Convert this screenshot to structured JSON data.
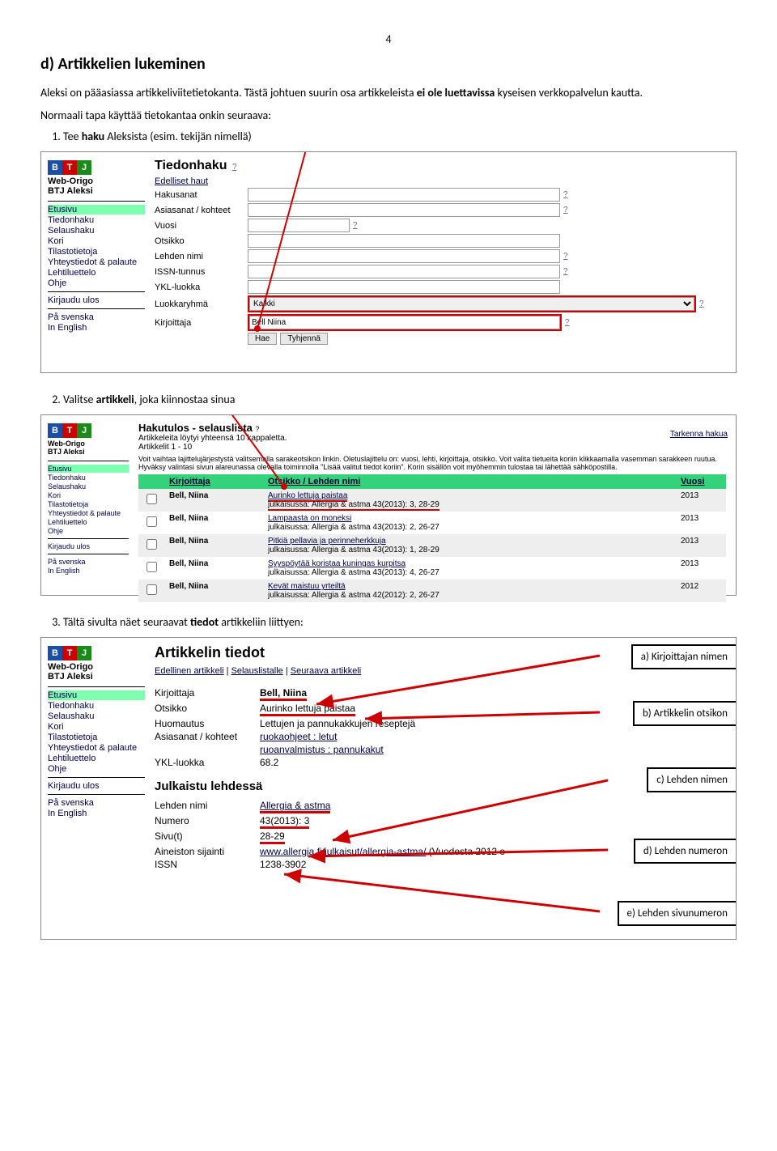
{
  "page_number": "4",
  "heading": "d) Artikkelien lukeminen",
  "para1_a": "Aleksi on pääasiassa artikkeliviitetietokanta. Tästä johtuen suurin osa artikkeleista ",
  "para1_b": "ei ole luettavissa",
  "para1_c": " kyseisen verkkopalvelun kautta.",
  "para2": "Normaali tapa käyttää tietokantaa onkin seuraava:",
  "step1_a": "Tee ",
  "step1_b": "haku",
  "step1_c": " Aleksista (esim. tekijän nimellä)",
  "step2_a": "Valitse ",
  "step2_b": "artikkeli",
  "step2_c": ", joka kiinnostaa sinua",
  "step3_a": "Tältä sivulta näet seuraavat ",
  "step3_b": "tiedot",
  "step3_c": " artikkeliin liittyen:",
  "logo": {
    "b": "B",
    "t": "T",
    "j": "J"
  },
  "brand1": "Web-Origo",
  "brand2": "BTJ Aleksi",
  "nav": {
    "etusivu": "Etusivu",
    "tiedonhaku": "Tiedonhaku",
    "selaushaku": "Selaushaku",
    "kori": "Kori",
    "tilasto": "Tilastotietoja",
    "yhteys": "Yhteystiedot & palaute",
    "lehti": "Lehtiluettelo",
    "ohje": "Ohje",
    "logout": "Kirjaudu ulos",
    "sv": "På svenska",
    "en": "In English"
  },
  "search": {
    "title": "Tiedonhaku",
    "prev": "Edelliset haut",
    "hakusanat": "Hakusanat",
    "asiasanat": "Asiasanat / kohteet",
    "vuosi": "Vuosi",
    "otsikko": "Otsikko",
    "lehden": "Lehden nimi",
    "issn": "ISSN-tunnus",
    "ykl": "YKL-luokka",
    "luokka": "Luokkaryhmä",
    "luokka_val": "Kaikki",
    "kirjoittaja": "Kirjoittaja",
    "kirjoittaja_val": "Bell Niina",
    "hae": "Hae",
    "tyhj": "Tyhjennä",
    "q": "?"
  },
  "results": {
    "title": "Hakutulos - selauslista",
    "count": "Artikkeleita löytyi yhteensä 10 kappaletta.",
    "range": "Artikkelit 1 - 10",
    "tarkenna": "Tarkenna hakua",
    "info": "Voit vaihtaa lajittelujärjestystä valitsemalla sarakeotsikon linkin. Oletuslajittelu on: vuosi, lehti, kirjoittaja, otsikko. Voit valita tietueita koriin klikkaamalla vasemman sarakkeen ruutua. Hyväksy valintasi sivun alareunassa olevalla toiminnolla \"Lisää valitut tiedot koriin\". Korin sisällön voit myöhemmin tulostaa tai lähettää sähköpostilla.",
    "col_kirj": "Kirjoittaja",
    "col_ots": "Otsikko / Lehden nimi",
    "col_vuosi": "Vuosi",
    "rows": [
      {
        "a": "Bell, Niina",
        "t": "Aurinko lettuja paistaa",
        "p": "julkaisussa: Allergia & astma 43(2013): 3, 28-29",
        "y": "2013"
      },
      {
        "a": "Bell, Niina",
        "t": "Lampaasta on moneksi",
        "p": "julkaisussa: Allergia & astma 43(2013): 2, 26-27",
        "y": "2013"
      },
      {
        "a": "Bell, Niina",
        "t": "Pitkiä pellavia ja perinneherkkuja",
        "p": "julkaisussa: Allergia & astma 43(2013): 1, 28-29",
        "y": "2013"
      },
      {
        "a": "Bell, Niina",
        "t": "Syyspöytää koristaa kuningas kurpitsa",
        "p": "julkaisussa: Allergia & astma 43(2013): 4, 26-27",
        "y": "2013"
      },
      {
        "a": "Bell, Niina",
        "t": "Kevät maistuu yrteiltä",
        "p": "julkaisussa: Allergia & astma 42(2012): 2, 26-27",
        "y": "2012"
      }
    ]
  },
  "detail": {
    "title": "Artikkelin tiedot",
    "prev": "Edellinen artikkeli",
    "list": "Selauslistalle",
    "next": "Seuraava artikkeli",
    "kirj_l": "Kirjoittaja",
    "kirj_v": "Bell, Niina",
    "ots_l": "Otsikko",
    "ots_v": "Aurinko lettuja paistaa",
    "huom_l": "Huomautus",
    "huom_v": "Lettujen ja pannukakkujen reseptejä",
    "as_l": "Asiasanat / kohteet",
    "as_v1": "ruokaohjeet : letut",
    "as_v2": "ruoanvalmistus : pannukakut",
    "ykl_l": "YKL-luokka",
    "ykl_v": "68.2",
    "pub_title": "Julkaistu lehdessä",
    "ln_l": "Lehden nimi",
    "ln_v": "Allergia & astma",
    "num_l": "Numero",
    "num_v": "43(2013): 3",
    "sivu_l": "Sivu(t)",
    "sivu_v": "28-29",
    "ain_l": "Aineiston sijainti",
    "ain_v": "www.allergia.fi/julkaisut/allergia-astma/",
    "ain_v2": " (Vuodesta 2012 o",
    "issn_l": "ISSN",
    "issn_v": "1238-3902"
  },
  "callouts": {
    "a": "a) Kirjoittajan nimen",
    "b": "b) Artikkelin otsikon",
    "c": "c) Lehden nimen",
    "d": "d) Lehden numeron",
    "e": "e) Lehden sivunumeron"
  }
}
